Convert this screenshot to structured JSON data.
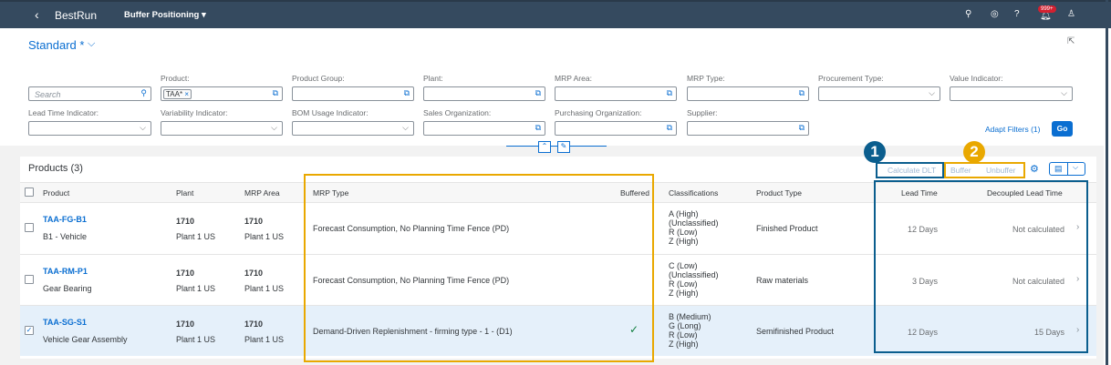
{
  "shell": {
    "back": "‹",
    "logo": "BestRun",
    "title": "Buffer Positioning ▾",
    "notif_badge": "999+"
  },
  "variant": {
    "name": "Standard *",
    "chevron": "⌵"
  },
  "filters": {
    "search_placeholder": "Search",
    "product": {
      "label": "Product:",
      "token": "TAA*"
    },
    "product_group": "Product Group:",
    "plant": "Plant:",
    "mrp_area": "MRP Area:",
    "mrp_type": "MRP Type:",
    "procurement_type": "Procurement Type:",
    "value_indicator": "Value Indicator:",
    "lead_time_indicator": "Lead Time Indicator:",
    "variability_indicator": "Variability Indicator:",
    "bom_usage_indicator": "BOM Usage Indicator:",
    "sales_org": "Sales Organization:",
    "purchasing_org": "Purchasing Organization:",
    "supplier": "Supplier:",
    "adapt": "Adapt Filters (1)",
    "go": "Go"
  },
  "table": {
    "title": "Products (3)",
    "toolbar": {
      "calc": "Calculate DLT",
      "buffer": "Buffer",
      "unbuffer": "Unbuffer"
    },
    "callouts": {
      "one": "1",
      "two": "2"
    },
    "headers": {
      "product": "Product",
      "plant": "Plant",
      "mrp_area": "MRP Area",
      "mrp_type": "MRP Type",
      "buffered": "Buffered",
      "class": "Classifications",
      "ptype": "Product Type",
      "lt": "Lead Time",
      "dlt": "Decoupled Lead Time"
    },
    "rows": [
      {
        "id": "TAA-FG-B1",
        "desc": "B1 - Vehicle",
        "plant": "1710",
        "plant_name": "Plant 1 US",
        "area": "1710",
        "area_name": "Plant 1 US",
        "mrp": "Forecast Consumption, No Planning Time Fence (PD)",
        "buffered": "",
        "c1": "A (High)",
        "c2": "(Unclassified)",
        "c3": "R (Low)",
        "c4": "Z (High)",
        "ptype": "Finished Product",
        "lt": "12 Days",
        "dlt": "Not calculated",
        "selected": false
      },
      {
        "id": "TAA-RM-P1",
        "desc": "Gear Bearing",
        "plant": "1710",
        "plant_name": "Plant 1 US",
        "area": "1710",
        "area_name": "Plant 1 US",
        "mrp": "Forecast Consumption, No Planning Time Fence (PD)",
        "buffered": "",
        "c1": "C (Low)",
        "c2": "(Unclassified)",
        "c3": "R (Low)",
        "c4": "Z (High)",
        "ptype": "Raw materials",
        "lt": "3 Days",
        "dlt": "Not calculated",
        "selected": false
      },
      {
        "id": "TAA-SG-S1",
        "desc": "Vehicle Gear Assembly",
        "plant": "1710",
        "plant_name": "Plant 1 US",
        "area": "1710",
        "area_name": "Plant 1 US",
        "mrp": "Demand-Driven Replenishment - firming type - 1 - (D1)",
        "buffered": "✓",
        "c1": "B (Medium)",
        "c2": "G (Long)",
        "c3": "R (Low)",
        "c4": "Z (High)",
        "ptype": "Semifinished Product",
        "lt": "12 Days",
        "dlt": "15 Days",
        "selected": true
      }
    ]
  },
  "colors": {
    "shell": "#354a5f",
    "accent": "#0a6ed1",
    "orange": "#e9a800",
    "blue_callout": "#0b5e8e"
  }
}
